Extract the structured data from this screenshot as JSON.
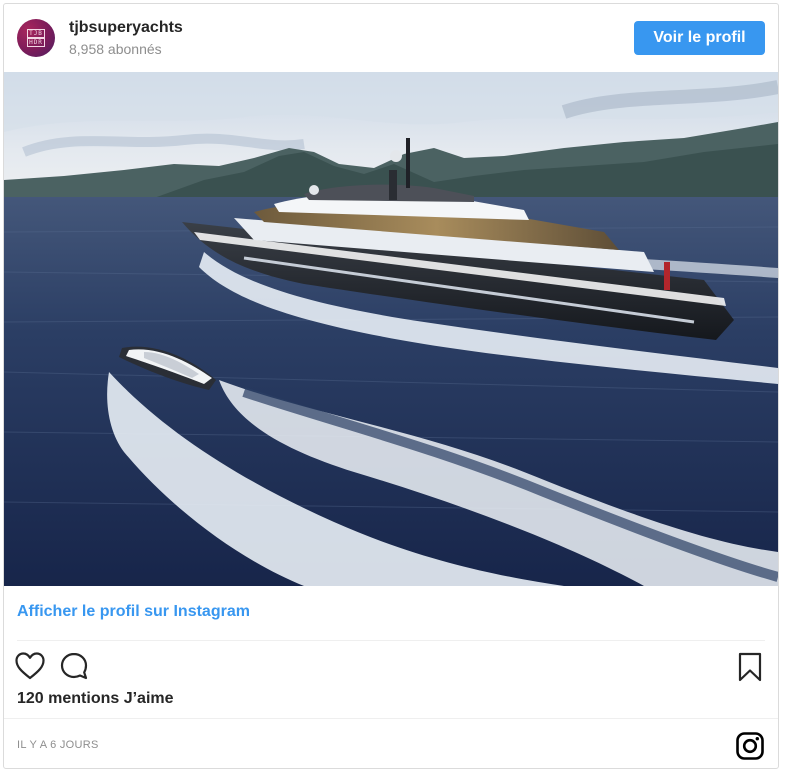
{
  "header": {
    "username": "tjbsuperyachts",
    "followers": "8,958 abonnés",
    "avatar_monogram_top": "TJB",
    "avatar_monogram_bottom": "HDR",
    "profile_button_label": "Voir le profil"
  },
  "photo": {
    "icon": "yacht-photo"
  },
  "link": {
    "label": "Afficher le profil sur Instagram"
  },
  "actions": {
    "like_icon": "heart-icon",
    "comment_icon": "comment-icon",
    "save_icon": "bookmark-icon"
  },
  "likes_text": "120 mentions J’aime",
  "timestamp": "IL Y A 6 JOURS",
  "footer_icon": "instagram-logo-icon",
  "colors": {
    "accent": "#3897f0",
    "text": "#262626",
    "muted": "#8e8e8e",
    "border": "#dbdbdb"
  }
}
